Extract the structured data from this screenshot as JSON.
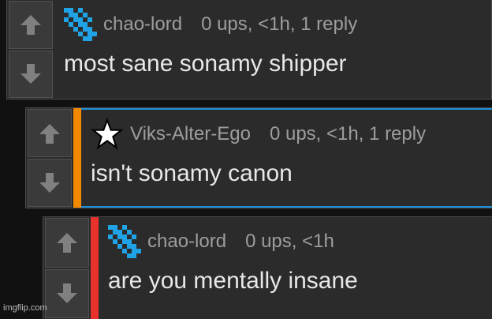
{
  "comments": [
    {
      "username": "chao-lord",
      "meta": "0 ups, <1h, 1 reply",
      "text": "most sane sonamy shipper",
      "avatar": "pixel-pattern-avatar-icon",
      "bar_color": ""
    },
    {
      "username": "Viks-Alter-Ego",
      "meta": "0 ups, <1h, 1 reply",
      "text": "isn't sonamy canon",
      "avatar": "star-avatar-icon",
      "bar_color": "#f28a00"
    },
    {
      "username": "chao-lord",
      "meta": "0 ups, <1h",
      "text": "are you mentally insane",
      "avatar": "pixel-pattern-avatar-icon",
      "bar_color": "#e8322b"
    }
  ],
  "icons": {
    "upvote": "up-arrow-icon",
    "downvote": "down-arrow-icon"
  },
  "colors": {
    "background": "#111111",
    "panel": "#2b2b2b",
    "accent_blue": "#1d8fd8"
  },
  "watermark": "imgflip.com"
}
